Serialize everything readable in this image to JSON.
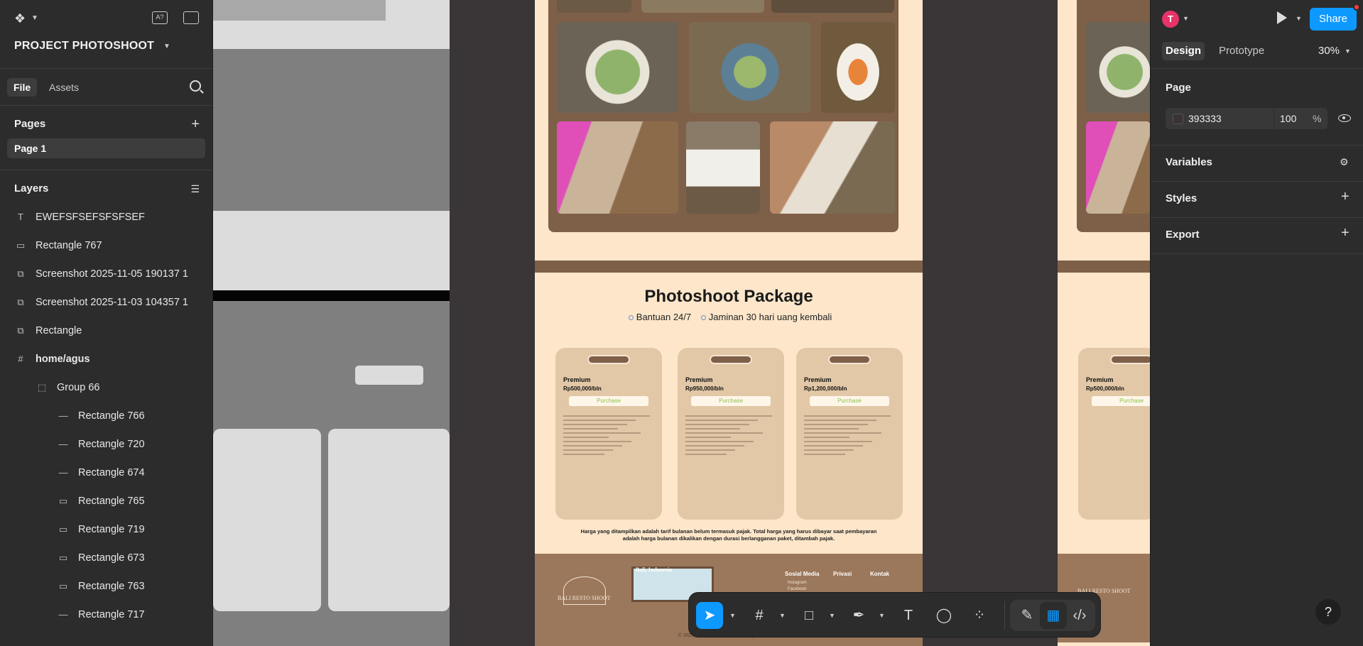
{
  "header": {
    "project_name": "PROJECT PHOTOSHOOT"
  },
  "left_tabs": [
    {
      "label": "File"
    },
    {
      "label": "Assets"
    }
  ],
  "pages": {
    "title": "Pages",
    "items": [
      {
        "label": "Page 1"
      }
    ]
  },
  "layers": {
    "title": "Layers",
    "items": [
      {
        "label": "EWEFSFSEFSFSFSEF",
        "icon": "text-icon",
        "glyph": "T",
        "indent": 0
      },
      {
        "label": "Rectangle 767",
        "icon": "rectangle-icon",
        "glyph": "▭",
        "indent": 0
      },
      {
        "label": "Screenshot 2025-11-05 190137 1",
        "icon": "image-icon",
        "glyph": "⧉",
        "indent": 0
      },
      {
        "label": "Screenshot 2025-11-03 104357 1",
        "icon": "image-icon",
        "glyph": "⧉",
        "indent": 0
      },
      {
        "label": "Rectangle",
        "icon": "image-icon",
        "glyph": "⧉",
        "indent": 0
      },
      {
        "label": "home/agus",
        "icon": "frame-icon",
        "glyph": "#",
        "indent": 0,
        "bold": true
      },
      {
        "label": "Group 66",
        "icon": "group-icon",
        "glyph": "⬚",
        "indent": 1
      },
      {
        "label": "Rectangle 766",
        "icon": "line-icon",
        "glyph": "—",
        "indent": 2
      },
      {
        "label": "Rectangle 720",
        "icon": "line-icon",
        "glyph": "—",
        "indent": 2
      },
      {
        "label": "Rectangle 674",
        "icon": "line-icon",
        "glyph": "—",
        "indent": 2
      },
      {
        "label": "Rectangle 765",
        "icon": "rectangle-icon",
        "glyph": "▭",
        "indent": 2
      },
      {
        "label": "Rectangle 719",
        "icon": "rectangle-icon",
        "glyph": "▭",
        "indent": 2
      },
      {
        "label": "Rectangle 673",
        "icon": "rectangle-icon",
        "glyph": "▭",
        "indent": 2
      },
      {
        "label": "Rectangle 763",
        "icon": "rectangle-icon",
        "glyph": "▭",
        "indent": 2
      },
      {
        "label": "Rectangle 717",
        "icon": "line-icon",
        "glyph": "—",
        "indent": 2
      }
    ]
  },
  "design": {
    "package_title": "Photoshoot Package",
    "sub_support": "Bantuan 24/7",
    "sub_guarantee": "Jaminan 30 hari uang kembali",
    "cards": [
      {
        "title": "Premium",
        "price": "Rp500,000/bln",
        "button": "Purchase"
      },
      {
        "title": "Premium",
        "price": "Rp950,000/bln",
        "button": "Purchase"
      },
      {
        "title": "Premium",
        "price": "Rp1,200,000/bln",
        "button": "Purchase"
      }
    ],
    "fine_print": "Harga yang ditampilkan adalah tarif bulanan belum termasuk pajak. Total harga yang harus dibayar saat pembayaran adalah harga bulanan dikalikan dengan durasi berlangganan paket, ditambah pajak.",
    "footer": {
      "logo_text": "BALI RESTO SHOOT",
      "map_label": "Bali, Indonesia",
      "cols": [
        "Sosial Media",
        "Privasi",
        "Kontak"
      ],
      "social_items": [
        "Instagram",
        "Facebook"
      ],
      "copyright": "© 2025 Bali Resto Photoshoot. All rights reserved."
    },
    "frame2_logo_text": "BALI RESTO SHOOT"
  },
  "right_panel": {
    "avatar_initial": "T",
    "share_label": "Share",
    "tabs": [
      {
        "label": "Design"
      },
      {
        "label": "Prototype"
      }
    ],
    "zoom": "30%",
    "page_section": "Page",
    "page_color_hex": "393333",
    "page_opacity": "100",
    "page_opacity_unit": "%",
    "sections": [
      "Variables",
      "Styles",
      "Export"
    ]
  },
  "colors": {
    "accent": "#0d99ff",
    "frame_bg": "#fde6ca",
    "brown": "#7e5f48",
    "canvas": "#3a3536"
  }
}
